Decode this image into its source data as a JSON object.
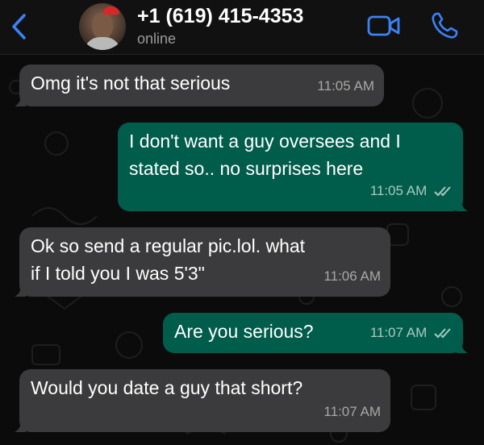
{
  "header": {
    "contact_name": "+1 (619) 415-4353",
    "status": "online",
    "icons": [
      "chevron-left-icon",
      "avatar",
      "video-camera-icon",
      "phone-icon"
    ],
    "accent_color": "#3b82f6"
  },
  "messages": [
    {
      "direction": "incoming",
      "text": "Omg it's not that serious",
      "time": "11:05 AM"
    },
    {
      "direction": "outgoing",
      "text": "I don't want a guy oversees and I\nstated so.. no surprises here",
      "time": "11:05 AM",
      "read": true
    },
    {
      "direction": "incoming",
      "text": "Ok so send a regular  pic.lol.  what\nif I told  you I was 5'3\"",
      "time": "11:06 AM"
    },
    {
      "direction": "outgoing",
      "text": "Are you serious?",
      "time": "11:07 AM",
      "read": true
    },
    {
      "direction": "incoming",
      "text": "Would you date a guy  that short?",
      "time": "11:07 AM"
    }
  ],
  "colors": {
    "incoming_bubble": "#3b3b3d",
    "outgoing_bubble": "#005c4b",
    "background": "#0b0b0b",
    "header_background": "#111111"
  }
}
